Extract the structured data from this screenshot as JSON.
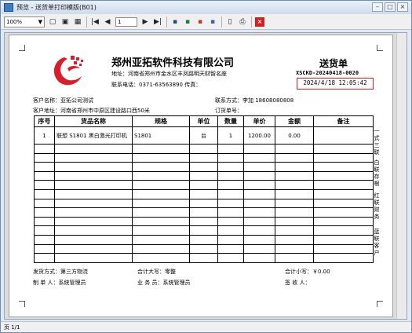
{
  "window": {
    "title": "预览 - 送货单打印模版(B01)"
  },
  "toolbar": {
    "zoom": "100%",
    "page_value": "1"
  },
  "status": {
    "page_info": "页 1/1"
  },
  "document": {
    "company": "郑州亚拓软件科技有限公司",
    "address": "地址：河南省郑州市金水区丰凤路明天财智名座",
    "phone": "联系电话：0371-63563890  传真：",
    "title": "送货单",
    "number": "XSCKD-20240418-0020",
    "date": "2024/4/18 12:05:42"
  },
  "customer": {
    "name_label": "客户名称：",
    "name": "亚拓公司测试",
    "contact_label": "联系方式：",
    "contact": "李加  18608080808",
    "addr_label": "客户地址：",
    "addr": "河南省郑州市中原区建设路口西50米",
    "order_label": "订货单号："
  },
  "table": {
    "headers": [
      "序号",
      "货品名称",
      "规格",
      "单位",
      "数量",
      "单价",
      "金额",
      "备注"
    ],
    "row1": {
      "no": "1",
      "name": "联想 S1801 黑白激光打印机",
      "spec": "S1801",
      "unit": "台",
      "qty": "1",
      "price": "1200.00",
      "amount": "0.00",
      "remark": ""
    }
  },
  "side_labels": {
    "copy1": "一式三联",
    "copy2": "白联存根",
    "copy3": "红联财务",
    "copy4": "蓝联客户"
  },
  "footer": {
    "ship_label": "发货方式：第三方物流",
    "total_big_label": "合计大写：零整",
    "total_small_label": "合计小写：￥0.00",
    "maker_label": "制 单 人：系统管理员",
    "sales_label": "业 务 员：系统管理员",
    "sign_label": "签 收 人："
  }
}
